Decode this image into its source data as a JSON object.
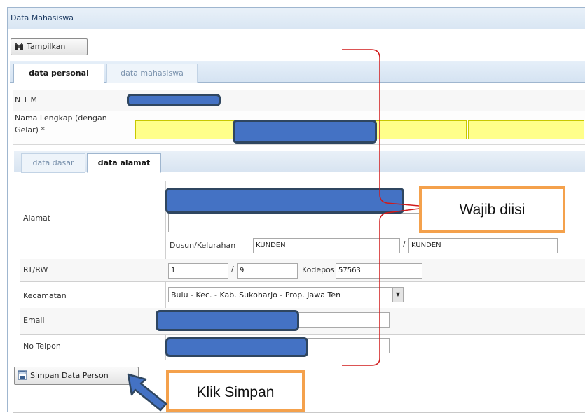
{
  "panel": {
    "title": "Data Mahasiswa"
  },
  "toolbar": {
    "tampilkan_label": "Tampilkan"
  },
  "tabs_main": [
    {
      "label": "data personal",
      "active": true
    },
    {
      "label": "data mahasiswa",
      "active": false
    }
  ],
  "personal": {
    "nim_label": "N I M",
    "nama_label_1": "Nama Lengkap (dengan",
    "nama_label_2": "Gelar) *"
  },
  "tabs_sub": [
    {
      "label": "data dasar",
      "active": false
    },
    {
      "label": "data alamat",
      "active": true
    }
  ],
  "alamat": {
    "alamat_label": "Alamat",
    "dusun_label": "Dusun/Kelurahan",
    "dusun_value": "KUNDEN",
    "slash": "/",
    "kelurahan_value": "KUNDEN",
    "rtrw_label": "RT/RW",
    "rt_value": "1",
    "rw_value": "9",
    "kodepos_label": "Kodepos",
    "kodepos_value": "57563",
    "kecamatan_label": "Kecamatan",
    "kecamatan_value": "Bulu - Kec. - Kab. Sukoharjo  - Prop. Jawa Ten",
    "email_label": "Email",
    "telpon_label": "No Telpon"
  },
  "save": {
    "label": "Simpan Data Person"
  },
  "annotations": {
    "wajib": "Wajib diisi",
    "klik": "Klik Simpan"
  },
  "colors": {
    "mask_fill": "#4472c4",
    "callout_border": "#f4a14c",
    "required_field": "#ffff8a",
    "bracket": "#d11a1a",
    "arrow": "#3c66a8"
  }
}
